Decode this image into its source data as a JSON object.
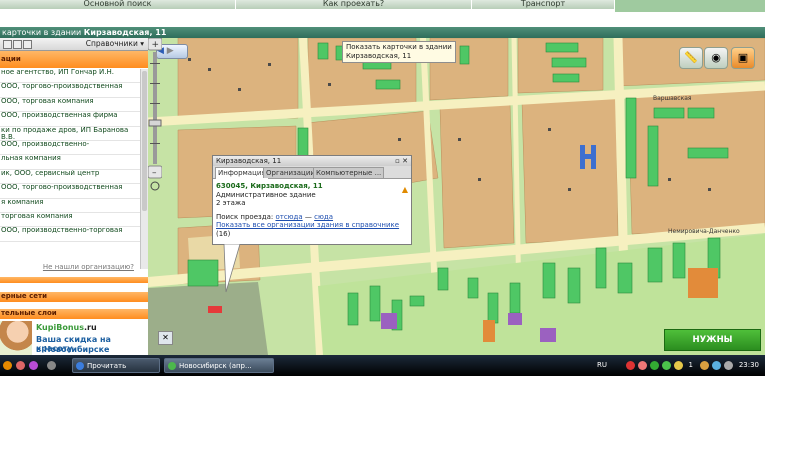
{
  "top_nav": [
    "Основной поиск",
    "Как проехать?",
    "Транспорт"
  ],
  "window_title": "карточки в здании",
  "window_title_address": "Кирзаводская, 11",
  "left_panel": {
    "references_label": "Справочники",
    "organizations_header": "ации",
    "list": [
      "ное агентство, ИП Гончар И.Н.",
      "ООО, торгово-производственная",
      "ООО, торговая компания",
      "ООО, производственная фирма",
      "ки по продаже дров, ИП Баранова В.В.",
      "ООО, производственно-",
      "льная компания",
      "ик, ООО, сервисный центр",
      "ООО, торгово-производственная",
      "я компания",
      "торговая компания",
      "ООО, производственно-торговая"
    ],
    "not_found": "Не нашли организацию?",
    "section_networks": "ерные сети",
    "section_layers": "тельные слои"
  },
  "ad": {
    "brand": "KupiBonus",
    "brand_suffix": ".ru",
    "line1": "Ваша скидка на красоту",
    "line2": "в Новосибирске"
  },
  "map": {
    "tooltip_line1": "Показать карточки в здании",
    "tooltip_line2": "Кирзаводская, 11",
    "popup": {
      "title": "Кирзаводская, 11",
      "tabs": [
        "Информация",
        "Организации",
        "Компьютерные ..."
      ],
      "address": "630045, Кирзаводская, 11",
      "type": "Административное здание",
      "floors": "2 этажа",
      "route_label": "Поиск проезда:",
      "route_from": "отсюда",
      "route_sep": "—",
      "route_to": "сюда",
      "show_all": "Показать все организации здания в справочнике",
      "show_all_count": "(16)"
    },
    "street_labels": [
      "Варшавская",
      "Немировича-Данченко"
    ],
    "clients_button": "НУЖНЫ КЛИЕНТЫ?",
    "colors": {
      "block": "#dcb37e",
      "road": "#f6f0c0",
      "green": "#c6e3a5",
      "building": "#4fc765"
    }
  },
  "taskbar": {
    "tasks": [
      "Прочитать сообще...",
      "Новосибирск (апр..."
    ],
    "lang": "RU",
    "tray_num": "1",
    "clock": "23:30"
  }
}
